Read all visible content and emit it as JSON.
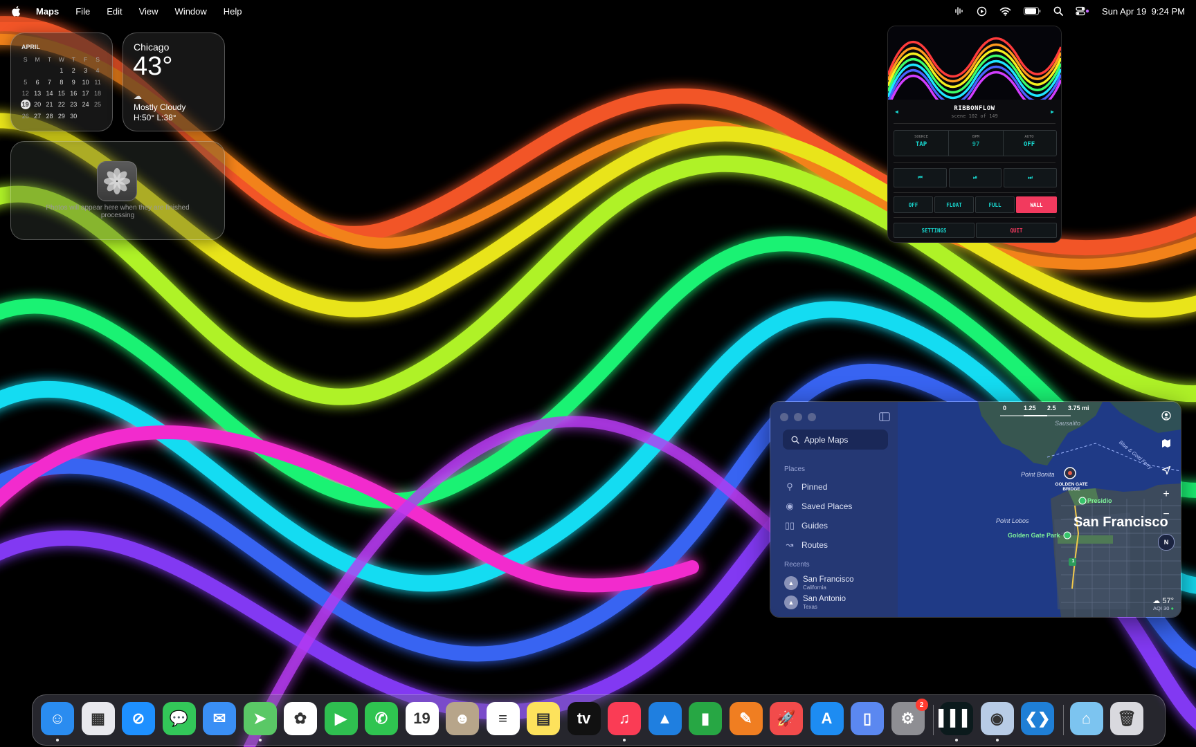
{
  "menubar": {
    "app": "Maps",
    "menus": [
      "File",
      "Edit",
      "View",
      "Window",
      "Help"
    ],
    "datetime": "Sun Apr 19  9:24 PM"
  },
  "calendar_widget": {
    "month": "APRIL",
    "weekdays": [
      "S",
      "M",
      "T",
      "W",
      "T",
      "F",
      "S"
    ],
    "weeks": [
      [
        "",
        "",
        "",
        "1",
        "2",
        "3",
        "4"
      ],
      [
        "5",
        "6",
        "7",
        "8",
        "9",
        "10",
        "11"
      ],
      [
        "12",
        "13",
        "14",
        "15",
        "16",
        "17",
        "18"
      ],
      [
        "19",
        "20",
        "21",
        "22",
        "23",
        "24",
        "25"
      ],
      [
        "26",
        "27",
        "28",
        "29",
        "30",
        "",
        ""
      ]
    ],
    "today": "19"
  },
  "weather_widget": {
    "city": "Chicago",
    "temp": "43°",
    "condition": "Mostly Cloudy",
    "high_low": "H:50° L:38°"
  },
  "photos_widget": {
    "message": "Photos will appear here when they are finished processing"
  },
  "ribbonflow": {
    "title": "RIBBONFLOW",
    "scene": "scene 102 of 149",
    "source_label": "SOURCE",
    "source_value": "TAP",
    "bpm_label": "BPM",
    "bpm_value": "97",
    "auto_label": "AUTO",
    "auto_value": "OFF",
    "transport": [
      "⏮",
      "⏯",
      "⏭"
    ],
    "modes": [
      "OFF",
      "FLOAT",
      "FULL",
      "WALL"
    ],
    "active_mode": "WALL",
    "settings": "SETTINGS",
    "quit": "QUIT",
    "accent": "#18d8d0",
    "danger": "#f23a5e"
  },
  "maps": {
    "search_placeholder": "Apple Maps",
    "places_header": "Places",
    "places": [
      {
        "label": "Pinned",
        "icon": "pin-icon"
      },
      {
        "label": "Saved Places",
        "icon": "saved-places-icon"
      },
      {
        "label": "Guides",
        "icon": "guides-icon"
      },
      {
        "label": "Routes",
        "icon": "routes-icon"
      }
    ],
    "recents_header": "Recents",
    "recents": [
      {
        "name": "San Francisco",
        "sub": "California"
      },
      {
        "name": "San Antonio",
        "sub": "Texas"
      }
    ],
    "scale": [
      "0",
      "1.25",
      "2.5",
      "3.75 mi"
    ],
    "labels": {
      "sausalito": "Sausalito",
      "point_bonita": "Point Bonita",
      "golden_gate": "GOLDEN GATE BRIDGE",
      "presidio": "Presidio",
      "point_lobos": "Point Lobos",
      "city": "San Francisco",
      "ggpark": "Golden Gate Park",
      "ferry": "Blue & Gold Ferry",
      "highway": "1"
    },
    "weather_temp": "57°",
    "aqi": "AQI 30",
    "compass": "N"
  },
  "dock": {
    "apps": [
      {
        "name": "Finder",
        "color": "#2a8cf0",
        "glyph": "☺",
        "running": true
      },
      {
        "name": "Launchpad",
        "color": "#e9e9ee",
        "glyph": "▦",
        "running": false
      },
      {
        "name": "Safari",
        "color": "#1e90ff",
        "glyph": "⊘",
        "running": false
      },
      {
        "name": "Messages",
        "color": "#33c759",
        "glyph": "💬",
        "running": false
      },
      {
        "name": "Mail",
        "color": "#3a8ff5",
        "glyph": "✉",
        "running": false
      },
      {
        "name": "Maps",
        "color": "#5ac866",
        "glyph": "➤",
        "running": true
      },
      {
        "name": "Photos",
        "color": "#ffffff",
        "glyph": "✿",
        "running": false
      },
      {
        "name": "FaceTime",
        "color": "#2fbf50",
        "glyph": "▶",
        "running": false
      },
      {
        "name": "Phone",
        "color": "#2fc450",
        "glyph": "✆",
        "running": false
      },
      {
        "name": "Calendar",
        "color": "#ffffff",
        "glyph": "19",
        "running": false
      },
      {
        "name": "Contacts",
        "color": "#b7a58a",
        "glyph": "☻",
        "running": false
      },
      {
        "name": "Reminders",
        "color": "#ffffff",
        "glyph": "≡",
        "running": false
      },
      {
        "name": "Notes",
        "color": "#fde25c",
        "glyph": "▤",
        "running": false
      },
      {
        "name": "TV",
        "color": "#111111",
        "glyph": "tv",
        "running": false
      },
      {
        "name": "Music",
        "color": "#fa3c55",
        "glyph": "♫",
        "running": true
      },
      {
        "name": "Keynote",
        "color": "#1f7fe0",
        "glyph": "▲",
        "running": false
      },
      {
        "name": "Numbers",
        "color": "#27a744",
        "glyph": "▮",
        "running": false
      },
      {
        "name": "Pages",
        "color": "#f07e21",
        "glyph": "✎",
        "running": false
      },
      {
        "name": "Rocket",
        "color": "#f24b4b",
        "glyph": "🚀",
        "running": false
      },
      {
        "name": "App Store",
        "color": "#1d8cf2",
        "glyph": "A",
        "running": false
      },
      {
        "name": "Simulator",
        "color": "#5b88f0",
        "glyph": "▯",
        "running": false
      },
      {
        "name": "System Settings",
        "color": "#8e8e93",
        "glyph": "⚙",
        "running": false,
        "badge": "2"
      },
      {
        "name": "RibbonFlow",
        "color": "#0b1a1c",
        "glyph": "▍▍▍",
        "running": true
      },
      {
        "name": "Disk Utility",
        "color": "#b8cce6",
        "glyph": "◉",
        "running": true
      },
      {
        "name": "VS Code",
        "color": "#1f7fd6",
        "glyph": "❮❯",
        "running": false
      },
      {
        "name": "Downloads",
        "color": "#7cc4f0",
        "glyph": "⌂",
        "running": false
      },
      {
        "name": "Trash",
        "color": "#d9d9de",
        "glyph": "🗑",
        "running": false
      }
    ]
  }
}
